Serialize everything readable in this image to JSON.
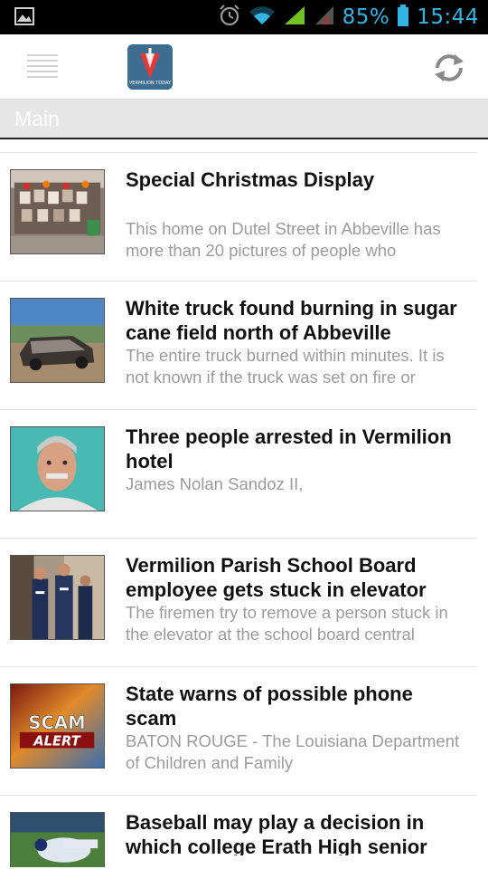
{
  "status_bar": {
    "battery": "85%",
    "time": "15:44",
    "icons": [
      "picture-icon",
      "alarm-icon",
      "wifi-icon",
      "signal-icon",
      "signal-no-data-icon",
      "battery-icon"
    ],
    "color": "#33b5e5"
  },
  "action_bar": {
    "logo_text": "VERMILION TODAY",
    "icons": [
      "hamburger-menu-icon",
      "refresh-icon"
    ]
  },
  "section": {
    "title": "Main"
  },
  "articles": [
    {
      "title": "Special Christmas Display",
      "description": "This home on Dutel Street in Abbeville has more than 20 pictures of people who",
      "thumbnail": "christmas-display-photo"
    },
    {
      "title": "White truck found burning in sugar cane field north of Abbeville",
      "description": "The entire truck burned within minutes.  It is not known if the truck was set on fire or",
      "thumbnail": "burned-truck-photo"
    },
    {
      "title": "Three people arrested in Vermilion hotel",
      "description": "James Nolan Sandoz II,",
      "thumbnail": "mugshot-photo"
    },
    {
      "title": "Vermilion Parish School Board employee gets stuck in elevator",
      "description": "The firemen try to remove a person stuck in the elevator at the school board central",
      "thumbnail": "firemen-photo"
    },
    {
      "title": "State warns of possible phone scam",
      "description": "BATON ROUGE - The Louisiana Department of Children and Family",
      "thumbnail": "scam-alert-image",
      "thumbnail_text": [
        "SCAM",
        "ALERT"
      ]
    },
    {
      "title": "Baseball may play a decision in which college Erath High senior",
      "description": "",
      "thumbnail": "baseball-photo"
    }
  ]
}
